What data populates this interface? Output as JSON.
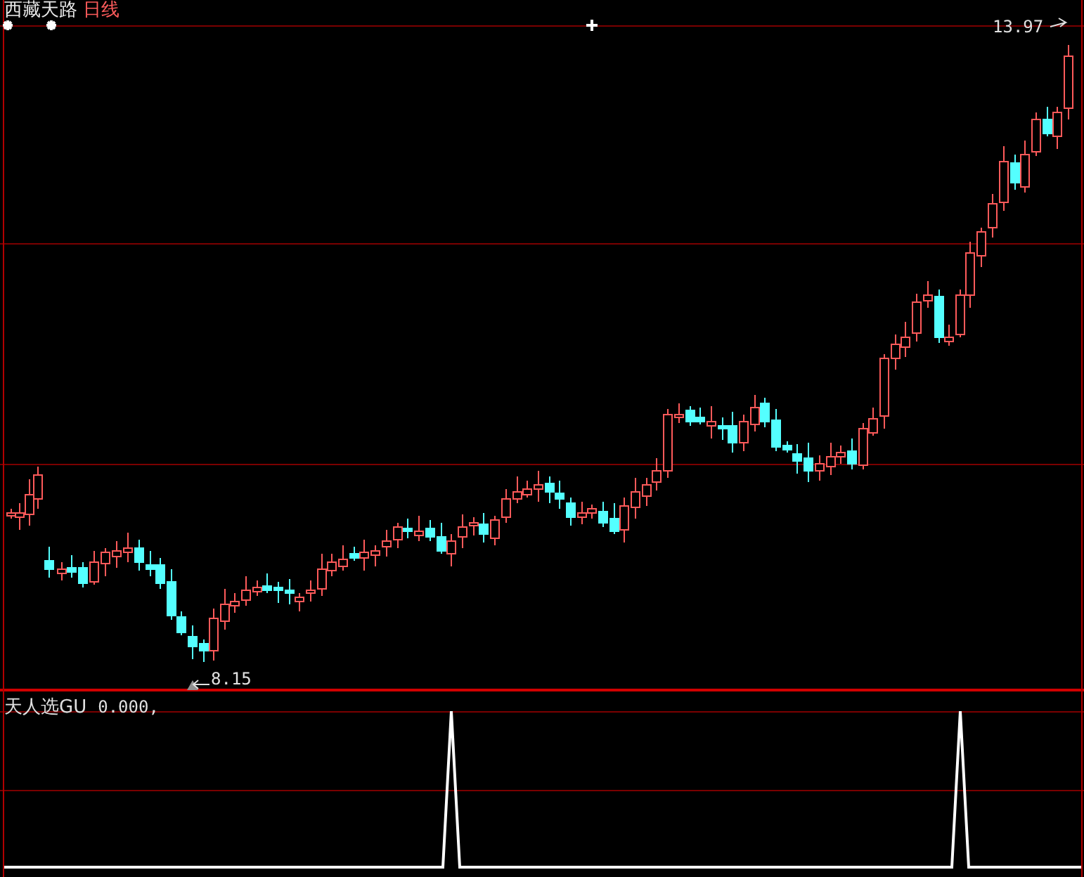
{
  "title": {
    "stock_name": "西藏天路",
    "period": "日线"
  },
  "price_chart": {
    "high_label": "13.97",
    "low_label": "8.15"
  },
  "indicator": {
    "name": "天人选GU",
    "value": "0.000,"
  }
}
